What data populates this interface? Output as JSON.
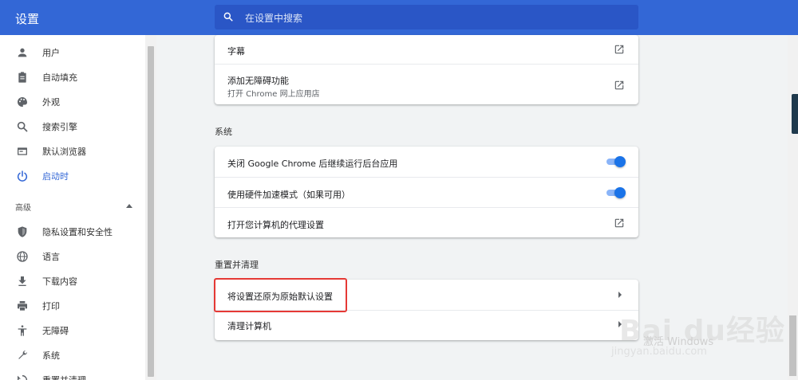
{
  "header": {
    "title": "设置",
    "search_placeholder": "在设置中搜索",
    "color": "#3367d6"
  },
  "sidebar": {
    "items": [
      {
        "label": "用户",
        "icon": "person-icon"
      },
      {
        "label": "自动填充",
        "icon": "clipboard-icon"
      },
      {
        "label": "外观",
        "icon": "palette-icon"
      },
      {
        "label": "搜索引擎",
        "icon": "search-icon"
      },
      {
        "label": "默认浏览器",
        "icon": "browser-window-icon"
      },
      {
        "label": "启动时",
        "icon": "power-icon",
        "active": true
      }
    ],
    "advanced_label": "高级",
    "advanced_items": [
      {
        "label": "隐私设置和安全性",
        "icon": "shield-icon"
      },
      {
        "label": "语言",
        "icon": "globe-icon"
      },
      {
        "label": "下载内容",
        "icon": "download-icon"
      },
      {
        "label": "打印",
        "icon": "printer-icon"
      },
      {
        "label": "无障碍",
        "icon": "accessibility-icon"
      },
      {
        "label": "系统",
        "icon": "wrench-icon"
      },
      {
        "label": "重置并清理",
        "icon": "reset-icon"
      }
    ]
  },
  "accessibility_card": {
    "captions_label": "字幕",
    "add_features_label": "添加无障碍功能",
    "add_features_sub": "打开 Chrome 网上应用店"
  },
  "system": {
    "title": "系统",
    "background_apps_label": "关闭 Google Chrome 后继续运行后台应用",
    "background_apps_on": true,
    "hardware_accel_label": "使用硬件加速模式（如果可用）",
    "hardware_accel_on": true,
    "proxy_label": "打开您计算机的代理设置"
  },
  "reset": {
    "title": "重置并清理",
    "restore_label": "将设置还原为原始默认设置",
    "cleanup_label": "清理计算机"
  },
  "watermark": {
    "brand": "Bai du经验",
    "url": "jingyan.baidu.com",
    "activate": "激活 Windows"
  }
}
